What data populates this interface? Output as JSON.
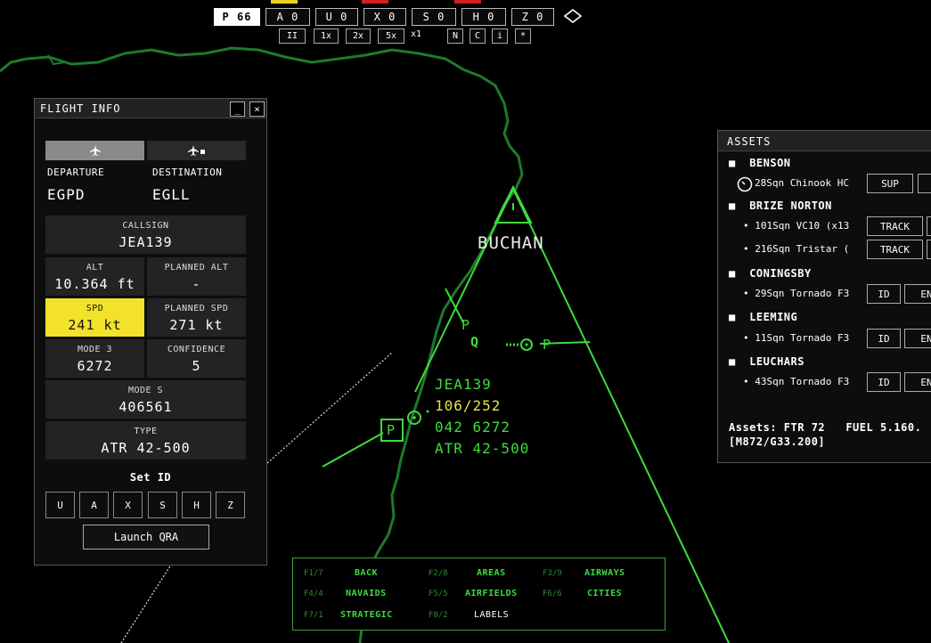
{
  "top_bar": {
    "buttons": [
      {
        "label": "P 66"
      },
      {
        "label": "A 0"
      },
      {
        "label": "U 0"
      },
      {
        "label": "X 0"
      },
      {
        "label": "S 0"
      },
      {
        "label": "H 0"
      },
      {
        "label": "Z 0"
      }
    ],
    "sub_buttons": [
      "II",
      "1x",
      "2x",
      "5x"
    ],
    "speed_text": "x1",
    "mode_buttons": [
      "N",
      "C",
      "i",
      "*"
    ],
    "indicator_colors": {
      "yellow": "#e8d21f",
      "red": "#d01f1f",
      "grey": "#555555"
    }
  },
  "flight_info": {
    "title": "FLIGHT INFO",
    "minimize": "_",
    "close": "×",
    "departure_label": "DEPARTURE",
    "departure": "EGPD",
    "destination_label": "DESTINATION",
    "destination": "EGLL",
    "callsign_label": "CALLSIGN",
    "callsign": "JEA139",
    "alt_label": "ALT",
    "alt": "10.364 ft",
    "planned_alt_label": "PLANNED ALT",
    "planned_alt": "-",
    "spd_label": "SPD",
    "spd": "241 kt",
    "planned_spd_label": "PLANNED SPD",
    "planned_spd": "271 kt",
    "mode3_label": "MODE 3",
    "mode3": "6272",
    "confidence_label": "CONFIDENCE",
    "confidence": "5",
    "modes_label": "MODE S",
    "modes": "406561",
    "type_label": "TYPE",
    "type": "ATR 42-500",
    "set_id_label": "Set ID",
    "id_buttons": [
      "U",
      "A",
      "X",
      "S",
      "H",
      "Z"
    ],
    "launch_label": "Launch QRA",
    "highlight_color": "#f2e22a"
  },
  "assets": {
    "title": "ASSETS",
    "bases": [
      {
        "name": "BENSON",
        "squadrons": [
          {
            "text": "28Sqn Chinook HC",
            "buttons": [
              "SUP",
              ""
            ]
          }
        ]
      },
      {
        "name": "BRIZE NORTON",
        "squadrons": [
          {
            "text": "101Sqn VC10 (x13",
            "buttons": [
              "TRACK",
              ""
            ]
          },
          {
            "text": "216Sqn Tristar (",
            "buttons": [
              "TRACK",
              ""
            ]
          }
        ]
      },
      {
        "name": "CONINGSBY",
        "squadrons": [
          {
            "text": "29Sqn Tornado F3",
            "buttons": [
              "ID",
              "EN"
            ]
          }
        ]
      },
      {
        "name": "LEEMING",
        "squadrons": [
          {
            "text": "11Sqn Tornado F3",
            "buttons": [
              "ID",
              "EN"
            ]
          }
        ]
      },
      {
        "name": "LEUCHARS",
        "squadrons": [
          {
            "text": "43Sqn Tornado F3",
            "buttons": [
              "ID",
              "EN"
            ]
          }
        ]
      }
    ],
    "footer_line1": "Assets: FTR 72   FUEL 5.160.",
    "footer_line2": "[M872/G33.200]"
  },
  "radar": {
    "beacon_name": "BUCHAN",
    "track_callsign": "JEA139",
    "track_line2": "106/252",
    "track_line3": "042 6272",
    "track_type": "ATR 42-500",
    "marker_p": "P",
    "marker_q": "Q",
    "line_color": "#1f7a2a",
    "symbol_color": "#3ddc3d"
  },
  "map_menu": {
    "items": [
      {
        "key": "F1/7",
        "label": "BACK"
      },
      {
        "key": "F2/8",
        "label": "AREAS"
      },
      {
        "key": "F3/9",
        "label": "AIRWAYS"
      },
      {
        "key": "F4/4",
        "label": "NAVAIDS"
      },
      {
        "key": "F5/5",
        "label": "AIRFIELDS"
      },
      {
        "key": "F6/6",
        "label": "CITIES"
      },
      {
        "key": "F7/1",
        "label": "STRATEGIC"
      },
      {
        "key": "F8/2",
        "label": "LABELS"
      }
    ]
  }
}
